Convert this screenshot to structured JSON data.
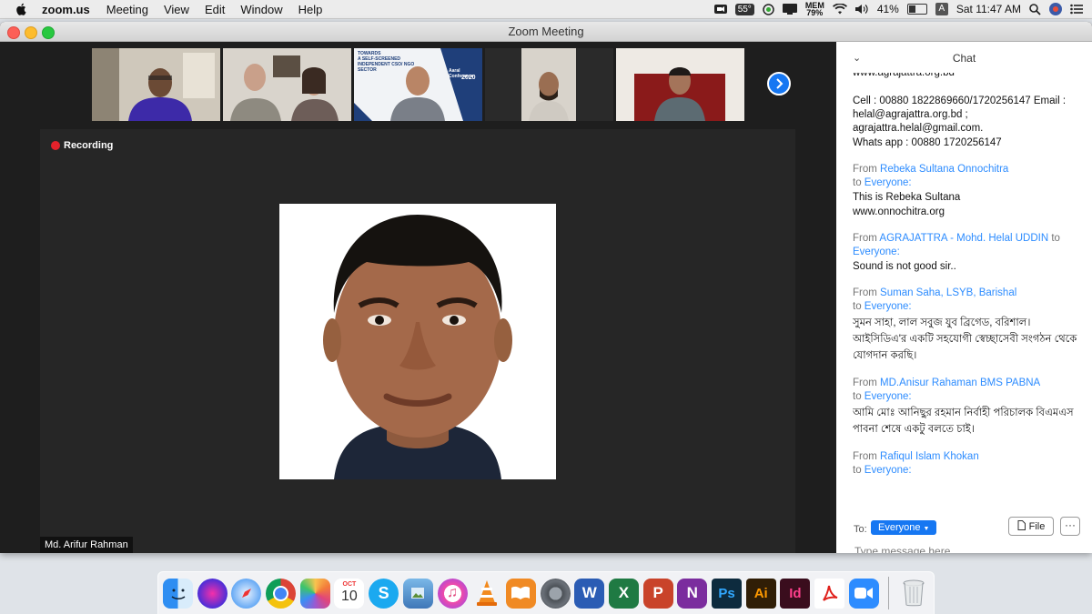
{
  "menubar": {
    "app_name": "zoom.us",
    "menus": [
      "Meeting",
      "View",
      "Edit",
      "Window",
      "Help"
    ],
    "status": {
      "temperature": "55°",
      "mem_label": "MEM",
      "mem_value": "79%",
      "battery_percent": "41%",
      "input_source": "A",
      "clock": "Sat 11:47 AM"
    }
  },
  "window": {
    "title": "Zoom Meeting"
  },
  "meeting": {
    "recording_label": "Recording",
    "active_speaker_name": "Md. Arifur Rahman",
    "thumbnail_slide_text": [
      "TOWARDS",
      "A SELF-SCREENED",
      "INDEPENDENT CSO/ NGO",
      "SECTOR",
      "Aaral Conference",
      "2020"
    ]
  },
  "chat": {
    "title": "Chat",
    "messages": [
      {
        "from": "",
        "to": "",
        "lines": [
          "www.agrajattra.org.bd",
          "",
          "Cell : 00880 1822869660/1720256147 Email : helal@agrajattra.org.bd ; agrajattra.helal@gmail.com.",
          "Whats app : 00880 1720256147"
        ]
      },
      {
        "from": "Rebeka Sultana Onnochitra",
        "to": "Everyone:",
        "lines": [
          "This is Rebeka Sultana",
          "www.onnochitra.org"
        ]
      },
      {
        "from": "AGRAJATTRA - Mohd. Helal UDDIN",
        "to": "Everyone:",
        "lines": [
          "Sound is not good sir.."
        ]
      },
      {
        "from": "Suman Saha, LSYB, Barishal",
        "to": "Everyone:",
        "lines": [
          "সুমন সাহা, লাল সবুজ যুব ব্রিগেড, বরিশাল। আইসিডিএ'র একটি সহযোগী স্বেচ্ছাসেবী সংগঠন থেকে যোগদান করছি।"
        ]
      },
      {
        "from": "MD.Anisur Rahaman BMS PABNA",
        "to": "Everyone:",
        "lines": [
          "আমি মোঃ আনিছুর রহমান নির্বাহী পরিচালক বিএমএস পাবনা শেষে একটু বলতে চাই।"
        ]
      },
      {
        "from": "Rafiqul Islam Khokan",
        "to": "Everyone:",
        "lines": []
      }
    ],
    "from_word": "From",
    "to_word": "to",
    "footer": {
      "to_label": "To:",
      "recipient": "Everyone",
      "file_label": "File",
      "more_label": "···",
      "input_placeholder": "Type message here..."
    }
  },
  "dock": {
    "calendar_month": "OCT",
    "calendar_day": "10",
    "apps": [
      "finder-icon",
      "siri-icon",
      "safari-icon",
      "chrome-icon",
      "photos-icon",
      "calendar-icon",
      "skype-icon",
      "preview-icon",
      "itunes-icon",
      "vlc-icon",
      "books-icon",
      "system-preferences-icon",
      "word-icon",
      "excel-icon",
      "powerpoint-icon",
      "onenote-icon",
      "photoshop-icon",
      "illustrator-icon",
      "indesign-icon",
      "acrobat-icon",
      "zoom-icon",
      "trash-icon"
    ],
    "labels": {
      "skype": "S",
      "word": "W",
      "excel": "X",
      "powerpoint": "P",
      "onenote": "N",
      "photoshop": "Ps",
      "illustrator": "Ai",
      "indesign": "Id"
    }
  }
}
